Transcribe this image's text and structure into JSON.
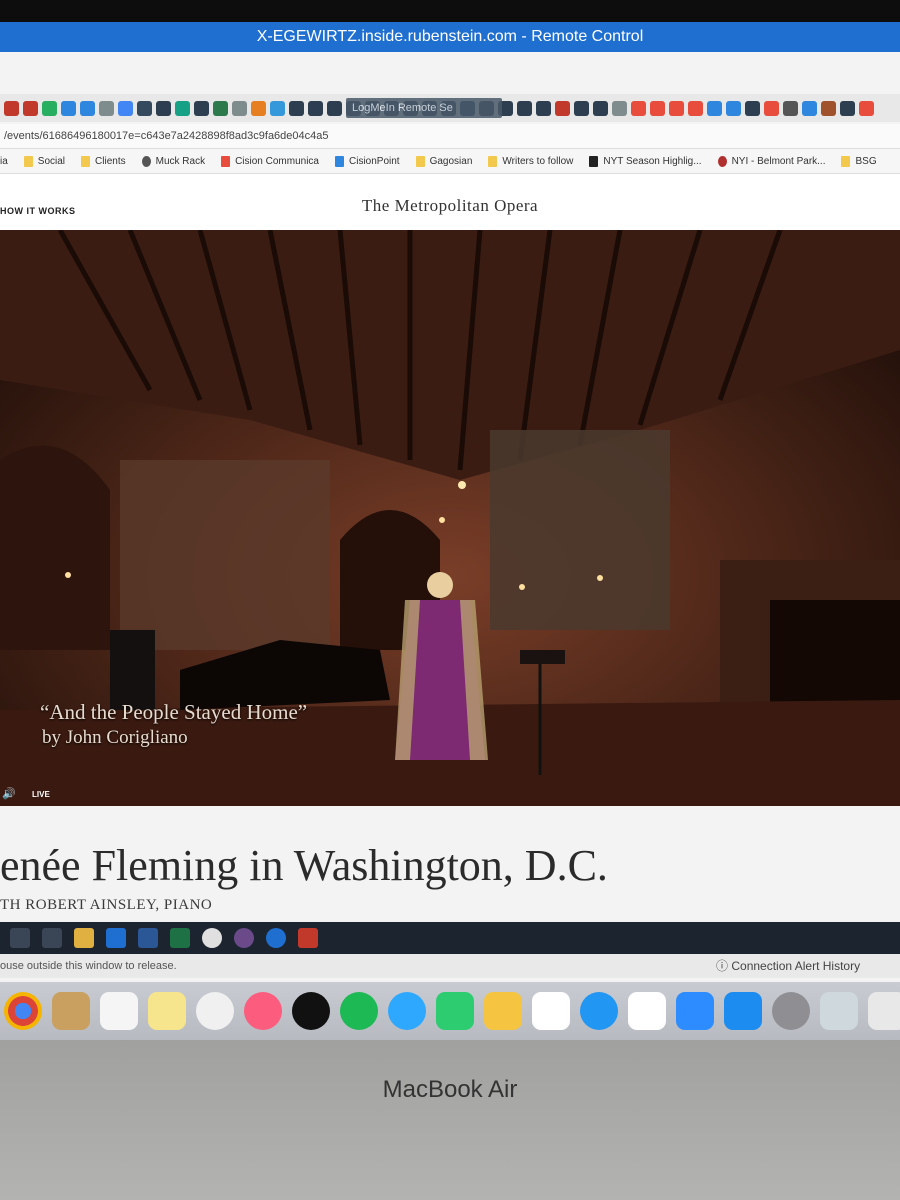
{
  "window": {
    "title": "X-EGEWIRTZ.inside.rubenstein.com - Remote Control"
  },
  "browser": {
    "overlay_label": "LogMeIn  Remote Se",
    "url": "/events/61686496180017e=c643e7a2428898f8ad3c9fa6de04c4a5",
    "bookmarks": [
      "ia",
      "Social",
      "Clients",
      "Muck Rack",
      "Cision Communica",
      "CisionPoint",
      "Gagosian",
      "Writers to follow",
      "NYT Season Highlig...",
      "NYI - Belmont Park...",
      "BSG"
    ]
  },
  "site": {
    "nav_link": "HOW IT WORKS",
    "brand_the": "The",
    "brand_name": "Metropolitan",
    "brand_opera": "Opera"
  },
  "video": {
    "caption_line1": "“And the People Stayed Home”",
    "caption_line2": "by John Corigliano",
    "live_label": "LIVE",
    "volume_icon": "speaker-icon"
  },
  "page": {
    "title": "enée Fleming in Washington, D.C.",
    "subtitle": "TH ROBERT AINSLEY, PIANO"
  },
  "remote": {
    "release_hint": "ouse outside this window to release.",
    "connection_alert": "Connection Alert History",
    "info_icon": "info-icon"
  },
  "hardware": {
    "laptop_label": "MacBook Air"
  },
  "colors": {
    "titlebar": "#1f6fd0",
    "taskbar": "#1c2430"
  }
}
